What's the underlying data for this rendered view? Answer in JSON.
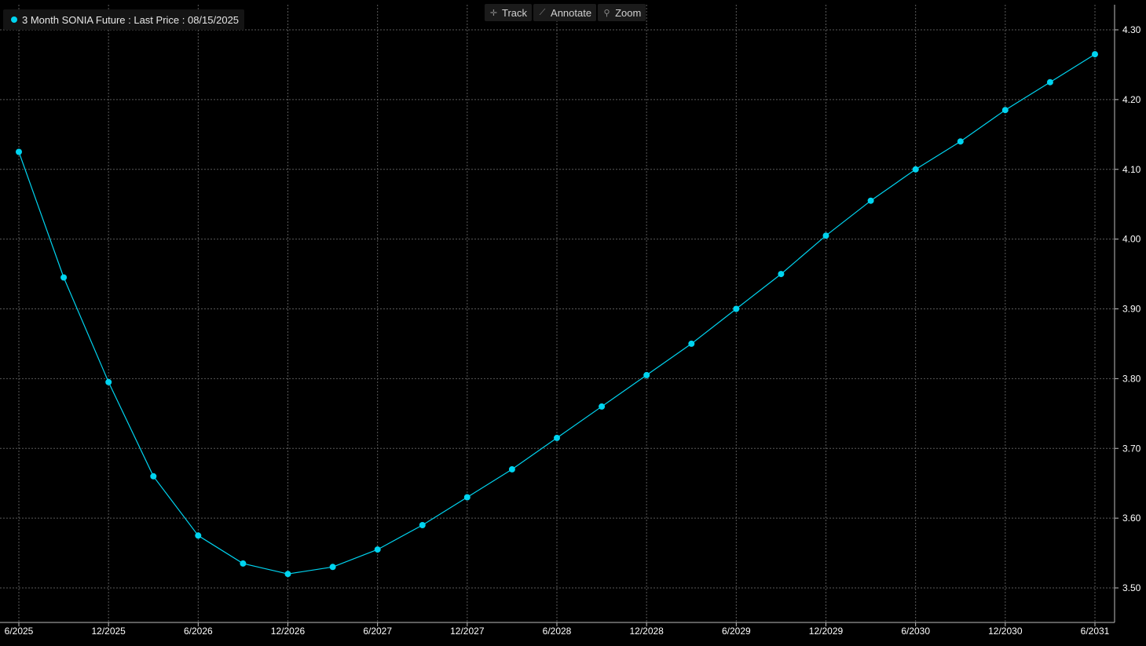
{
  "legend": {
    "label": "3 Month SONIA Future : Last Price : 08/15/2025",
    "color": "#00d4f0"
  },
  "toolbar": {
    "track_label": "Track",
    "track_icon": "crosshair-icon",
    "annotate_label": "Annotate",
    "annotate_icon": "pencil-icon",
    "zoom_label": "Zoom",
    "zoom_icon": "magnifier-icon"
  },
  "colors": {
    "background": "#000000",
    "series": "#00d4f0",
    "grid": "#5a5a5a",
    "axis_text": "#ffffff"
  },
  "chart_data": {
    "type": "line",
    "title": "",
    "xlabel": "",
    "ylabel": "",
    "y_axis_side": "right",
    "grid": true,
    "legend_placement": "top-left",
    "ylim": [
      3.45,
      4.31
    ],
    "xlim": [
      "6/2025",
      "6/2031"
    ],
    "x_tick_labels": [
      "6/2025",
      "12/2025",
      "6/2026",
      "12/2026",
      "6/2027",
      "12/2027",
      "6/2028",
      "12/2028",
      "6/2029",
      "12/2029",
      "6/2030",
      "12/2030",
      "6/2031"
    ],
    "y_ticks": [
      3.5,
      3.6,
      3.7,
      3.8,
      3.9,
      4.0,
      4.1,
      4.2,
      4.3
    ],
    "y_tick_labels": [
      "3.50",
      "3.60",
      "3.70",
      "3.80",
      "3.90",
      "4.00",
      "4.10",
      "4.20",
      "4.30"
    ],
    "series": [
      {
        "name": "3 Month SONIA Future : Last Price : 08/15/2025",
        "color": "#00d4f0",
        "x": [
          "6/2025",
          "9/2025",
          "12/2025",
          "3/2026",
          "6/2026",
          "9/2026",
          "12/2026",
          "3/2027",
          "6/2027",
          "9/2027",
          "12/2027",
          "3/2028",
          "6/2028",
          "9/2028",
          "12/2028",
          "3/2029",
          "6/2029",
          "9/2029",
          "12/2029",
          "3/2030",
          "6/2030",
          "9/2030",
          "12/2030",
          "3/2031",
          "6/2031"
        ],
        "values": [
          4.125,
          3.945,
          3.795,
          3.66,
          3.575,
          3.535,
          3.52,
          3.53,
          3.555,
          3.59,
          3.63,
          3.67,
          3.715,
          3.76,
          3.805,
          3.85,
          3.9,
          3.95,
          4.005,
          4.055,
          4.1,
          4.14,
          4.185,
          4.225,
          4.265
        ]
      }
    ]
  }
}
